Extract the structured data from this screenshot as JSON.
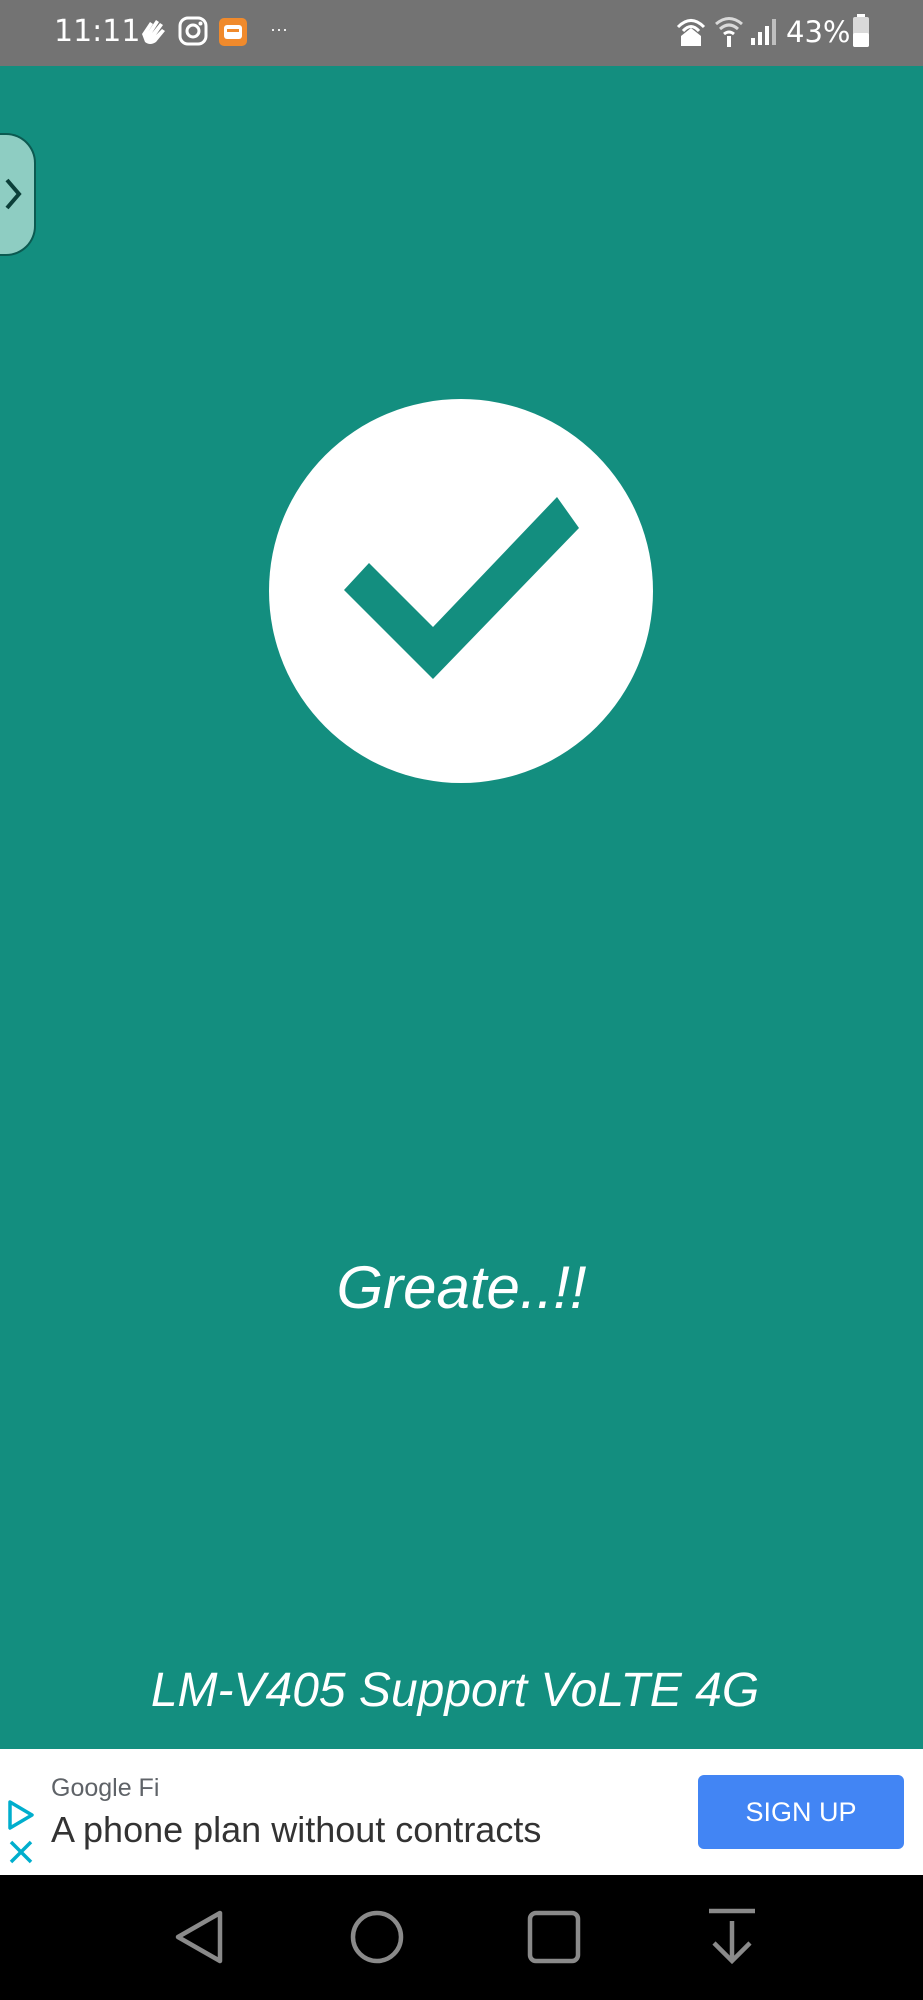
{
  "status_bar": {
    "time": "11:11",
    "notification_more": "···",
    "battery_percent": "43%"
  },
  "main": {
    "greeting": "Greate..!!",
    "device_support": "LM-V405 Support VoLTE 4G"
  },
  "ad": {
    "advertiser": "Google Fi",
    "headline": "A phone plan without contracts",
    "cta_label": "SIGN UP"
  },
  "colors": {
    "background": "#138e7f",
    "status_bar": "#737373",
    "ad_cta": "#4285f4",
    "nav_bar": "#000000"
  },
  "icons": {
    "status_left": [
      "hand-wave-icon",
      "instagram-icon",
      "app-notification-icon"
    ],
    "status_right": [
      "hotspot-icon",
      "wifi-icon",
      "signal-icon",
      "battery-icon"
    ],
    "nav": [
      "back-icon",
      "home-icon",
      "recents-icon",
      "download-icon"
    ]
  }
}
